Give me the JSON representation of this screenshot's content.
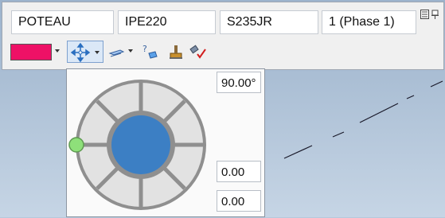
{
  "toolbar": {
    "fields": {
      "name": "POTEAU",
      "profile": "IPE220",
      "material": "S235JR",
      "phase": "1 (Phase 1)"
    },
    "color": "#ee1166"
  },
  "position_popup": {
    "rotation_angle": "90.00°",
    "offset_value_1": "0.00",
    "offset_value_2": "0.00",
    "colors": {
      "ring": "#8f8f8f",
      "center": "#3c7fc4",
      "handle": "#8ee07a"
    }
  },
  "icons": [
    "color-dropdown-icon",
    "position-icon",
    "rebar-icon",
    "help-select-icon",
    "paint-icon",
    "check-tool-icon",
    "panel-layout-icon",
    "pin-icon"
  ]
}
